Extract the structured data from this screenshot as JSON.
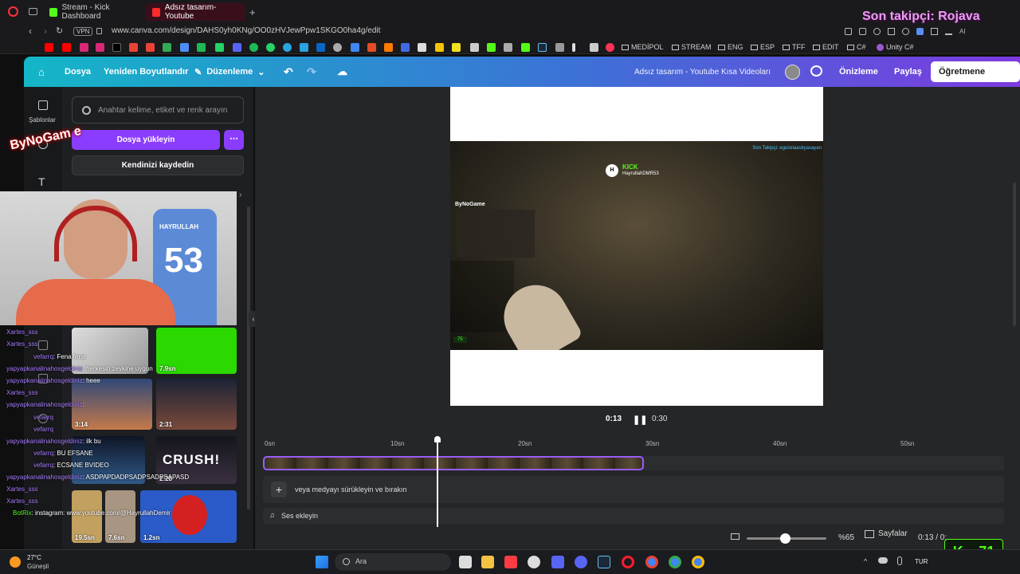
{
  "browser": {
    "tabs": [
      "Stream - Kick Dashboard",
      "Adsız tasarım- Youtube"
    ],
    "url": "www.canva.com/design/DAHS0yh0KNg/OO0zHVJewPpw1SKGO0ha4g/edit",
    "vpn": "VPN",
    "bookmarks": [
      "MEDİPOL",
      "STREAM",
      "ENG",
      "ESP",
      "TFF",
      "EDIT",
      "C#",
      "Unity C#"
    ]
  },
  "overlay": {
    "follower": "Son takipçi: Rojava",
    "logo": "ByNoGam e"
  },
  "header": {
    "file": "Dosya",
    "resize": "Yeniden Boyutlandır",
    "edit": "Düzenleme",
    "title": "Adsız tasarım - Youtube Kısa Videoları",
    "preview": "Önizleme",
    "share": "Paylaş",
    "send": "Öğretmene gönder"
  },
  "rail": {
    "templates": "Şablonlar"
  },
  "panel": {
    "search_placeholder": "Anahtar kelime, etiket ve renk arayın",
    "upload": "Dosya yükleyin",
    "record": "Kendinizi kaydedin"
  },
  "thumbs": [
    {
      "dur": "7.9sn",
      "color": "#2bd800"
    },
    {
      "dur": "3:14",
      "color": "#3b4b6b"
    },
    {
      "dur": "2:31",
      "color": "#20283a"
    },
    {
      "dur": "2:28",
      "color": "#1b1b22"
    },
    {
      "dur": "19.5sn",
      "color": "#6e5b38"
    },
    {
      "dur": "7.6sn",
      "color": "#8a7a6a"
    },
    {
      "dur": "1.2sn",
      "color": "#2a5bc8"
    }
  ],
  "crush_text": "CRUSH!",
  "chat": [
    {
      "u": "Xartes_sss",
      "t": ""
    },
    {
      "u": "Xartes_sss",
      "t": ""
    },
    {
      "u": "vefarrq",
      "t": ": Fena fena"
    },
    {
      "u": "yapyapkanalinahosgeldiniz",
      "t": ": herkesin zevkine uygun"
    },
    {
      "u": "yapyapkanalinahosgeldiniz",
      "t": ": heee"
    },
    {
      "u": "Xartes_sss",
      "t": ""
    },
    {
      "u": "yapyapkanalinahosgeldiniz",
      "t": ":"
    },
    {
      "u": "vefarrq",
      "t": ""
    },
    {
      "u": "vefarrq",
      "t": ""
    },
    {
      "u": "yapyapkanalinahosgeldiniz",
      "t": ": ilk bu"
    },
    {
      "u": "vefarrq",
      "t": ": BU EFSANE"
    },
    {
      "u": "vefarrq",
      "t": ": ECSANE BVIDEO"
    },
    {
      "u": "yapyapkanalinahosgeldiniz",
      "t": ": ASDPAPDADPSADPSADPSAPASD"
    },
    {
      "u": "Xartes_sss",
      "t": ""
    },
    {
      "u": "Xartes_sss",
      "t": ""
    },
    {
      "u": "BotRix",
      "t": ": instagram: www.youtube.com/@HayrullahDemir"
    }
  ],
  "webcam": {
    "jersey_name": "HAYRULLAH",
    "jersey_number": "53"
  },
  "video": {
    "follower": "Son Takipçi: egezelaaskyasayan",
    "kick_brand": "KICK",
    "kick_user": "HayrullahDMR53",
    "logo": "ByNoGame",
    "counter": "75"
  },
  "player": {
    "current": "0:13",
    "total": "0:30"
  },
  "timeline": {
    "ticks": [
      "0sn",
      "10sn",
      "20sn",
      "30sn",
      "40sn",
      "50sn"
    ],
    "add_media": "veya medyayı sürükleyin ve bırakın",
    "add_audio": "Ses ekleyin"
  },
  "footer": {
    "zoom": "%65",
    "pages": "Sayfalar",
    "time": "0:13 / 0:"
  },
  "kick_badge": "71",
  "taskbar": {
    "temp": "27°C",
    "weather": "Güneşli",
    "search": "Ara",
    "lang": "TUR"
  },
  "colors": {
    "accent": "#8b3dff",
    "kick": "#53fc18"
  }
}
